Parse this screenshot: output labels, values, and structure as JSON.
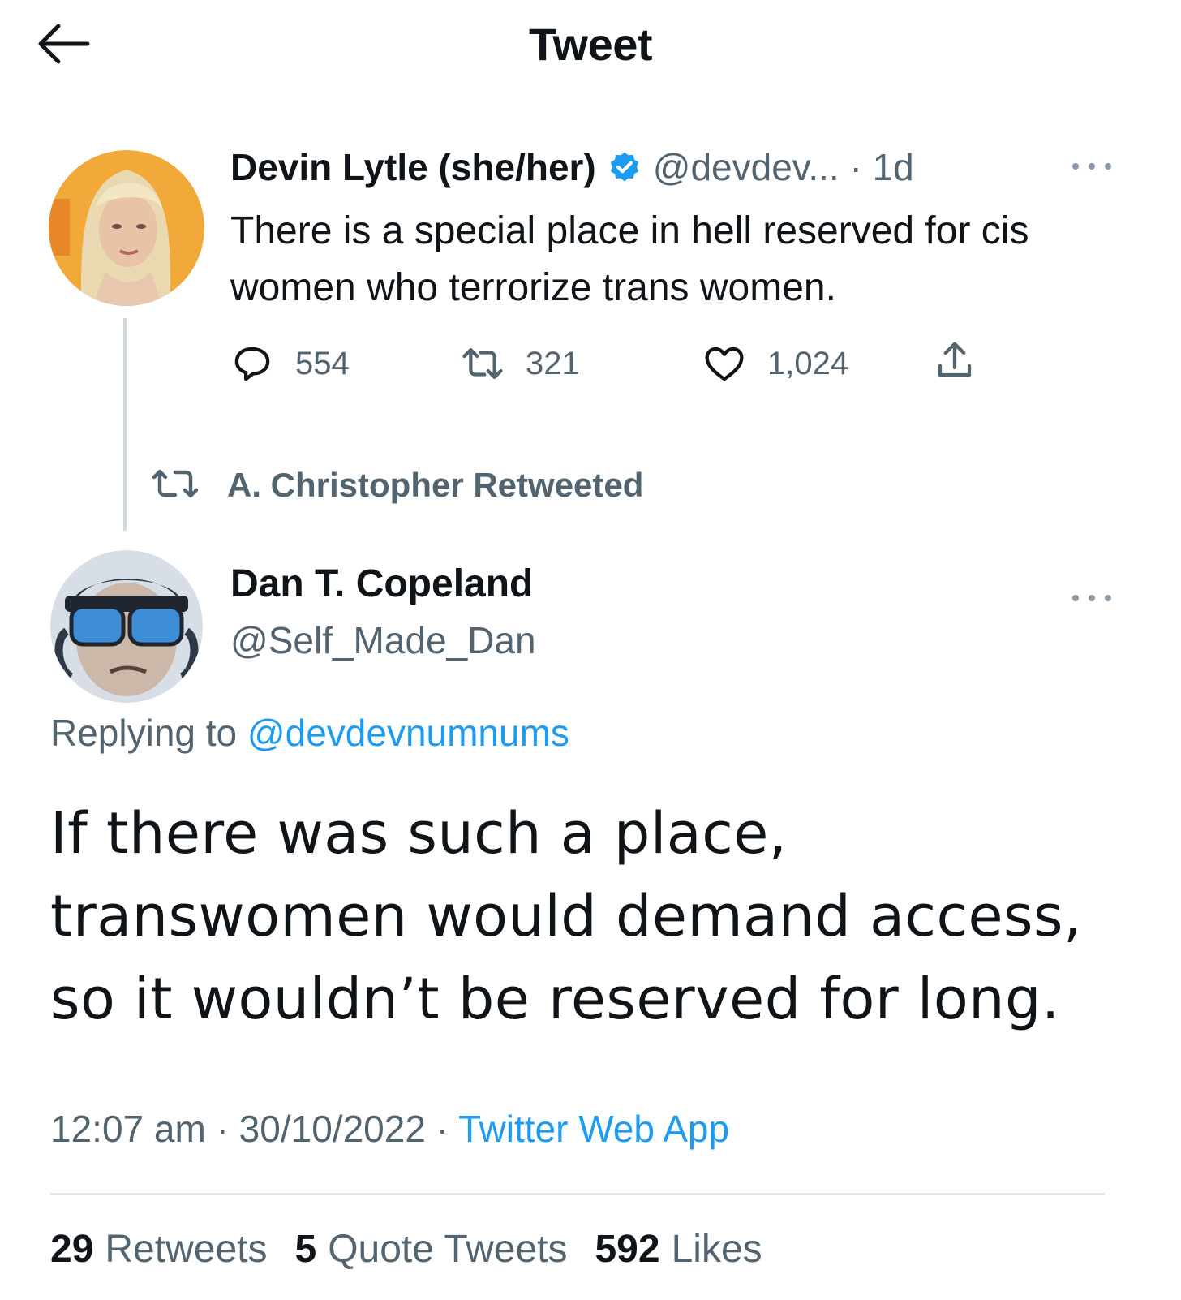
{
  "header": {
    "title": "Tweet"
  },
  "tweet1": {
    "name": "Devin Lytle (she/her)",
    "handle_time": "@devdev... · 1d",
    "text": "There is a special place in hell reserved for cis women who terrorize trans women.",
    "replies": "554",
    "retweets": "321",
    "likes": "1,024"
  },
  "retweet_notice": "A. Christopher Retweeted",
  "tweet2": {
    "name": "Dan T. Copeland",
    "handle": "@Self_Made_Dan",
    "replying_prefix": "Replying to",
    "replying_handle": "@devdevnumnums",
    "text_line1": "If there was such a place,",
    "text_line2": "transwomen would demand access,",
    "text_line3": "so it wouldn’t be reserved for long.",
    "timestamp": "12:07 am · 30/10/2022 ·",
    "app": "Twitter Web App"
  },
  "stats": {
    "retweets_count": "29",
    "retweets_label": "Retweets",
    "quotes_count": "5",
    "quotes_label": "Quote Tweets",
    "likes_count": "592",
    "likes_label": "Likes"
  },
  "colors": {
    "accent": "#1d9bf0",
    "secondary_text": "#536471",
    "primary_text": "#0f1419"
  },
  "icons": [
    "back-arrow-icon",
    "verified-badge-icon",
    "more-icon",
    "reply-icon",
    "retweet-icon",
    "like-icon",
    "share-icon"
  ]
}
